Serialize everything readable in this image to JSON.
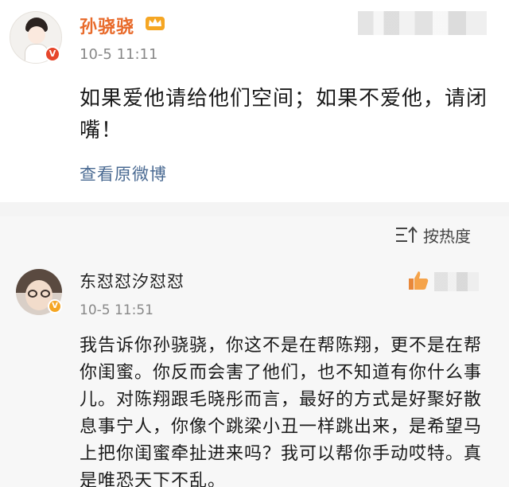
{
  "post": {
    "author": "孙骁骁",
    "time": "10-5 11:11",
    "content": "如果爱他请给他们空间；如果不爱他，请闭嘴！",
    "view_original": "查看原微博",
    "avatar_badge": "V"
  },
  "comments": {
    "sort_label": "按热度",
    "items": [
      {
        "author": "东怼怼汐怼怼",
        "time": "10-5 11:51",
        "content": "我告诉你孙骁骁，你这不是在帮陈翔，更不是在帮你闺蜜。你反而会害了他们，也不知道有你什么事儿。对陈翔跟毛晓彤而言，最好的方式是好聚好散息事宁人，你像个跳梁小丑一样跳出来，是希望马上把你闺蜜牵扯进来吗？我可以帮你手动哎特。真是唯恐天下不乱。",
        "avatar_badge": "V"
      }
    ]
  },
  "colors": {
    "author_name": "#e86a2a",
    "link": "#4a6a92",
    "badge_orange": "#f5a623",
    "badge_red": "#e6462b"
  },
  "icons": {
    "crown": "crown-icon",
    "sort": "sort-icon",
    "like": "thumbs-up-icon"
  }
}
